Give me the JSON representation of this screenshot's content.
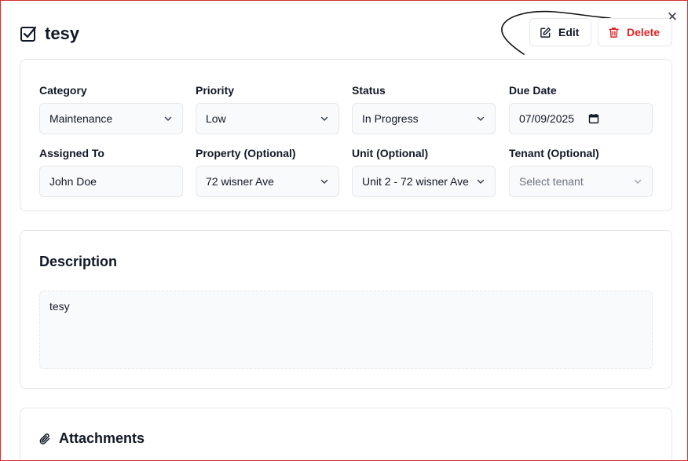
{
  "task": {
    "title": "tesy",
    "icon": "checkbox-icon"
  },
  "actions": {
    "edit_label": "Edit",
    "delete_label": "Delete",
    "delete_color": "#dc2626"
  },
  "details": {
    "category": {
      "label": "Category",
      "value": "Maintenance"
    },
    "priority": {
      "label": "Priority",
      "value": "Low"
    },
    "status": {
      "label": "Status",
      "value": "In Progress"
    },
    "due_date": {
      "label": "Due Date",
      "value": "07/09/2025"
    },
    "assigned_to": {
      "label": "Assigned To",
      "value": "John Doe"
    },
    "property": {
      "label": "Property (Optional)",
      "value": "72 wisner Ave"
    },
    "unit": {
      "label": "Unit (Optional)",
      "value": "Unit 2 - 72 wisner Ave"
    },
    "tenant": {
      "label": "Tenant (Optional)",
      "placeholder": "Select tenant"
    }
  },
  "description": {
    "heading": "Description",
    "text": "tesy"
  },
  "attachments": {
    "heading": "Attachments"
  },
  "colors": {
    "frame_border": "#d32f2f",
    "field_bg": "#f9fafb",
    "border": "#e5e7eb"
  }
}
